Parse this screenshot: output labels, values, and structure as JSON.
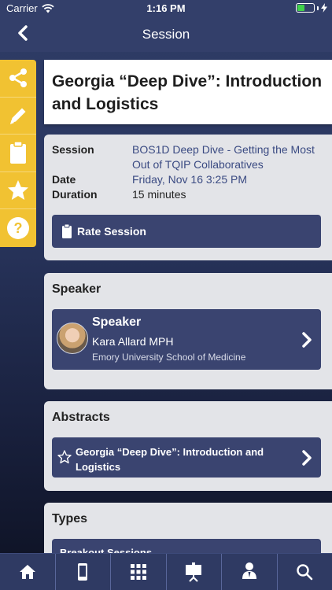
{
  "status_bar": {
    "carrier": "Carrier",
    "time": "1:16 PM",
    "battery_level": 0.45
  },
  "header": {
    "title": "Session",
    "back_icon": "chevron-left-icon"
  },
  "side_rail": {
    "icons": [
      "share-icon",
      "pencil-icon",
      "clipboard-icon",
      "star-icon",
      "help-icon"
    ],
    "accent_color": "#f1c232"
  },
  "session": {
    "title": "Georgia “Deep Dive”: Introduction and Logistics",
    "fields": [
      {
        "label": "Session",
        "value": "BOS1D Deep Dive - Getting the Most Out of TQIP Collaboratives"
      },
      {
        "label": "Date",
        "value": "Friday, Nov 16 3:25 PM"
      },
      {
        "label": "Duration",
        "value": "15 minutes"
      }
    ],
    "rate_button": "Rate Session"
  },
  "speaker_section": {
    "heading": "Speaker",
    "card": {
      "title": "Speaker",
      "name": "Kara Allard MPH",
      "organization": "Emory University School of Medicine"
    }
  },
  "abstracts_section": {
    "heading": "Abstracts",
    "item": "Georgia “Deep Dive”: Introduction and Logistics"
  },
  "types_section": {
    "heading": "Types",
    "item": "Breakout Sessions"
  },
  "tab_bar": {
    "tabs": [
      "home-icon",
      "mobile-phone-icon",
      "grid-icon",
      "presentation-icon",
      "person-icon",
      "search-icon"
    ]
  },
  "colors": {
    "navy": "#333f6a",
    "button": "#3a4470",
    "card": "#e3e4e8",
    "link": "#3a4a82"
  }
}
